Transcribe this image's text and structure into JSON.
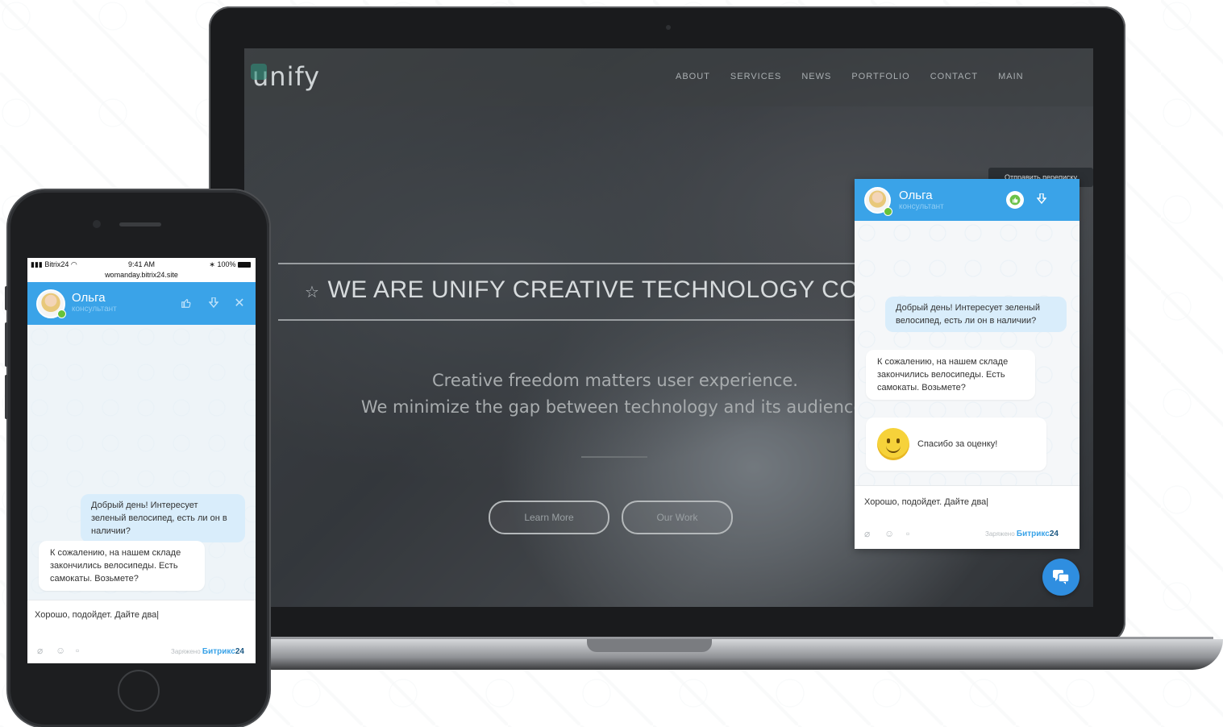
{
  "site": {
    "logo": "unify",
    "nav": [
      "ABOUT",
      "SERVICES",
      "NEWS",
      "PORTFOLIO",
      "CONTACT",
      "MAIN"
    ],
    "hero_title": "WE ARE UNIFY CREATIVE TECHNOLOGY COMP",
    "hero_sub_1": "Creative freedom matters user experience.",
    "hero_sub_2": "We minimize the gap between technology and its audience.",
    "btn_learn": "Learn More",
    "btn_work": "Our Work"
  },
  "chat": {
    "operator_name": "Ольга",
    "operator_role": "консультант",
    "tooltip": "Отправить переписку",
    "msg_out": "Добрый день! Интересует зеленый велосипед, есть ли он в наличии?",
    "msg_in": "К сожалению, на нашем складе закончились велосипеды. Есть самокаты. Возьмете?",
    "rating_thanks": "Спасибо за оценку!",
    "input_value": "Хорошо, подойдет. Дайте два|",
    "powered_prefix": "Заряжено",
    "powered_brand": "Битрикс",
    "powered_num": "24"
  },
  "phone": {
    "carrier": "Bitrix24",
    "time": "9:41 AM",
    "battery": "100%",
    "url": "womanday.bitrix24.site"
  },
  "icons": {
    "like": "thumbs-up-icon",
    "download": "download-icon",
    "close": "close-icon",
    "attach": "paperclip-icon",
    "emoji": "smile-icon",
    "file": "file-icon",
    "fab": "chat-bubbles-icon"
  },
  "colors": {
    "accent": "#3aa3e8",
    "online": "#67c23a",
    "bubble_out": "#d9edfb"
  }
}
